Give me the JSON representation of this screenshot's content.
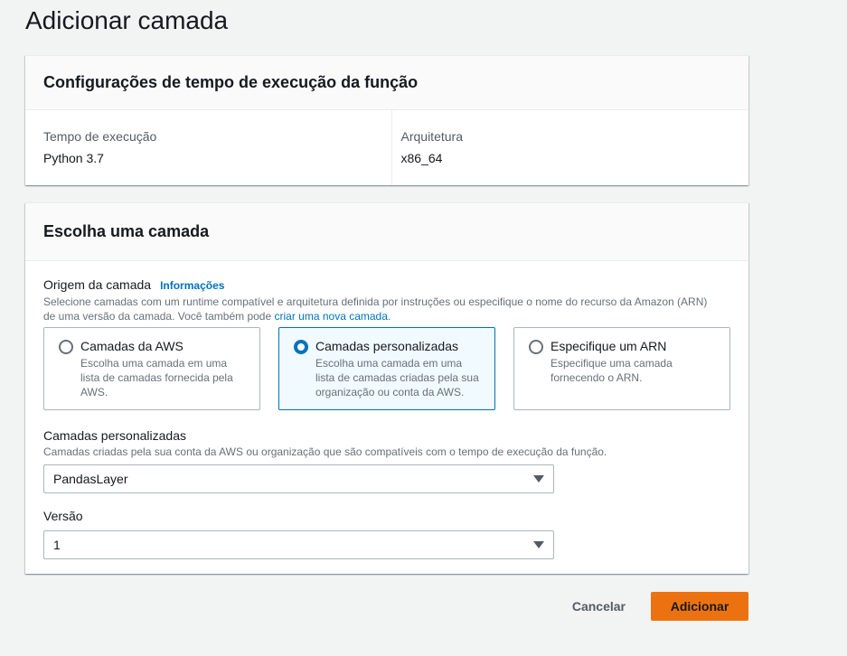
{
  "page": {
    "title": "Adicionar camada"
  },
  "runtime_settings": {
    "header": "Configurações de tempo de execução da função",
    "runtime_label": "Tempo de execução",
    "runtime_value": "Python 3.7",
    "architecture_label": "Arquitetura",
    "architecture_value": "x86_64"
  },
  "layer_choice": {
    "header": "Escolha uma camada",
    "source_label": "Origem da camada",
    "info_link": "Informações",
    "source_desc_line1": "Selecione camadas com um runtime compatível e arquitetura definida por instruções ou especifique o nome do recurso da Amazon (ARN)",
    "source_desc_line2_prefix": "de uma versão da camada. Você também pode ",
    "create_layer_link": "criar uma nova camada",
    "source_desc_line2_suffix": ".",
    "tiles": [
      {
        "title": "Camadas da AWS",
        "desc": "Escolha uma camada em uma lista de camadas fornecida pela AWS.",
        "selected": false
      },
      {
        "title": "Camadas personalizadas",
        "desc": "Escolha uma camada em uma lista de camadas criadas pela sua organização ou conta da AWS.",
        "selected": true
      },
      {
        "title": "Especifique um ARN",
        "desc": "Especifique uma camada fornecendo o ARN.",
        "selected": false
      }
    ],
    "custom_layers_label": "Camadas personalizadas",
    "custom_layers_desc": "Camadas criadas pela sua conta da AWS ou organização que são compatíveis com o tempo de execução da função.",
    "custom_layers_value": "PandasLayer",
    "version_label": "Versão",
    "version_value": "1"
  },
  "actions": {
    "cancel": "Cancelar",
    "add": "Adicionar"
  },
  "colors": {
    "primary_button": "#ec7211",
    "link": "#0073bb",
    "selected_tile_border": "#0073bb",
    "selected_tile_bg": "#f1faff"
  }
}
